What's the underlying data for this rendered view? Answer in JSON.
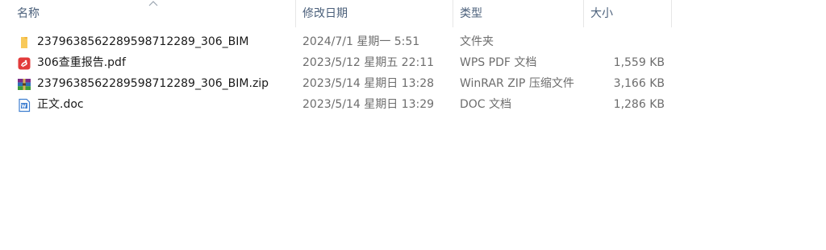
{
  "columns": {
    "name": "名称",
    "modified": "修改日期",
    "type": "类型",
    "size": "大小"
  },
  "files": [
    {
      "name": "2379638562289598712289_306_BIM",
      "modified": "2024/7/1 星期一 5:51",
      "type": "文件夹",
      "size": "",
      "icon": "folder-icon"
    },
    {
      "name": "306查重报告.pdf",
      "modified": "2023/5/12 星期五 22:11",
      "type": "WPS PDF 文档",
      "size": "1,559 KB",
      "icon": "pdf-icon"
    },
    {
      "name": "2379638562289598712289_306_BIM.zip",
      "modified": "2023/5/14 星期日 13:28",
      "type": "WinRAR ZIP 压缩文件",
      "size": "3,166 KB",
      "icon": "zip-archive-icon"
    },
    {
      "name": "正文.doc",
      "modified": "2023/5/14 星期日 13:29",
      "type": "DOC 文档",
      "size": "1,286 KB",
      "icon": "word-doc-icon"
    }
  ]
}
